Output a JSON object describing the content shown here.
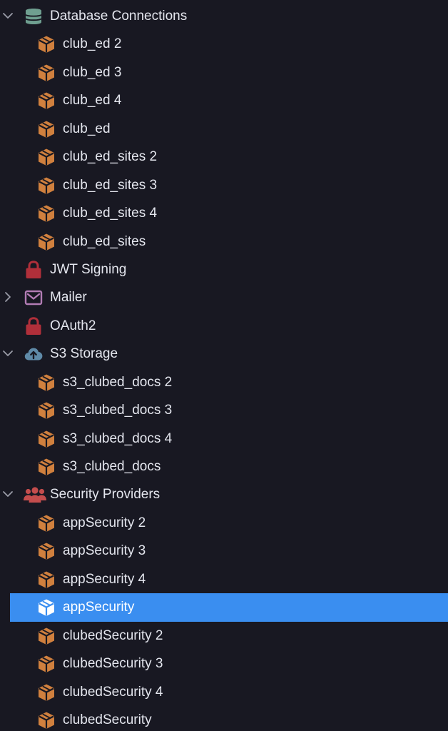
{
  "colors": {
    "background": "#181822",
    "text": "#e4e6ee",
    "selection": "#3a8ef0",
    "chevron": "#9a9ca8",
    "package_icon": "#d0803e",
    "package_icon_selected": "#ffffff",
    "database_icon": "#6f9f90",
    "lock_icon": "#b02f3a",
    "mail_icon": "#b27cb4",
    "cloud_icon": "#5f8aa8",
    "users_icon": "#c44d4d"
  },
  "tree": [
    {
      "label": "Database Connections",
      "level": 0,
      "icon": "database-icon",
      "chevron": "down"
    },
    {
      "label": "club_ed 2",
      "level": 1,
      "icon": "package-icon"
    },
    {
      "label": "club_ed 3",
      "level": 1,
      "icon": "package-icon"
    },
    {
      "label": "club_ed 4",
      "level": 1,
      "icon": "package-icon"
    },
    {
      "label": "club_ed",
      "level": 1,
      "icon": "package-icon"
    },
    {
      "label": "club_ed_sites 2",
      "level": 1,
      "icon": "package-icon"
    },
    {
      "label": "club_ed_sites 3",
      "level": 1,
      "icon": "package-icon"
    },
    {
      "label": "club_ed_sites 4",
      "level": 1,
      "icon": "package-icon"
    },
    {
      "label": "club_ed_sites",
      "level": 1,
      "icon": "package-icon"
    },
    {
      "label": "JWT Signing",
      "level": 0,
      "icon": "lock-icon",
      "chevron": "none"
    },
    {
      "label": "Mailer",
      "level": 0,
      "icon": "mail-icon",
      "chevron": "right"
    },
    {
      "label": "OAuth2",
      "level": 0,
      "icon": "lock-icon",
      "chevron": "none"
    },
    {
      "label": "S3 Storage",
      "level": 0,
      "icon": "cloud-upload-icon",
      "chevron": "down"
    },
    {
      "label": "s3_clubed_docs 2",
      "level": 1,
      "icon": "package-icon"
    },
    {
      "label": "s3_clubed_docs 3",
      "level": 1,
      "icon": "package-icon"
    },
    {
      "label": "s3_clubed_docs 4",
      "level": 1,
      "icon": "package-icon"
    },
    {
      "label": "s3_clubed_docs",
      "level": 1,
      "icon": "package-icon"
    },
    {
      "label": "Security Providers",
      "level": 0,
      "icon": "users-icon",
      "chevron": "down"
    },
    {
      "label": "appSecurity 2",
      "level": 1,
      "icon": "package-icon"
    },
    {
      "label": "appSecurity 3",
      "level": 1,
      "icon": "package-icon"
    },
    {
      "label": "appSecurity 4",
      "level": 1,
      "icon": "package-icon"
    },
    {
      "label": "appSecurity",
      "level": 1,
      "icon": "package-icon",
      "selected": true
    },
    {
      "label": "clubedSecurity 2",
      "level": 1,
      "icon": "package-icon"
    },
    {
      "label": "clubedSecurity 3",
      "level": 1,
      "icon": "package-icon"
    },
    {
      "label": "clubedSecurity 4",
      "level": 1,
      "icon": "package-icon"
    },
    {
      "label": "clubedSecurity",
      "level": 1,
      "icon": "package-icon"
    }
  ]
}
